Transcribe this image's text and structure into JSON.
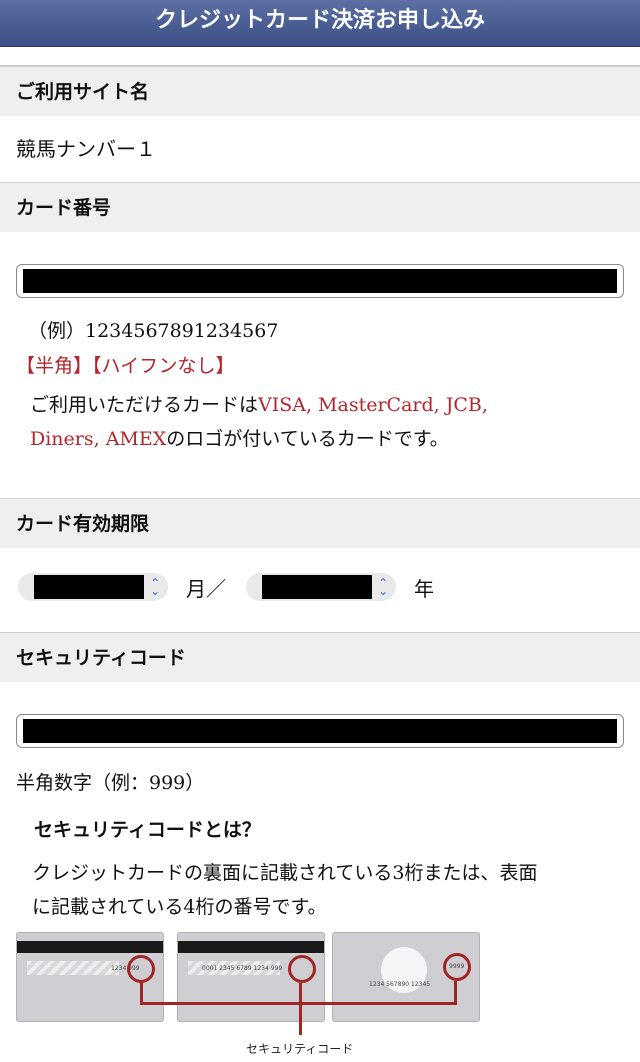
{
  "header": {
    "title": "クレジットカード決済お申し込み"
  },
  "site": {
    "label": "ご利用サイト名",
    "value": "競馬ナンバー１"
  },
  "card_number": {
    "label": "カード番号",
    "example": "（例）1234567891234567",
    "hint": "【半角】【ハイフンなし】",
    "notice_prefix": "ご利用いただけるカードは",
    "brands_line1": "VISA, MasterCard, JCB,",
    "brands_line2": "Diners, AMEX",
    "notice_suffix": "のロゴが付いているカードです。"
  },
  "expiry": {
    "label": "カード有効期限",
    "month_unit": "月／",
    "year_unit": "年"
  },
  "security": {
    "label": "セキュリティコード",
    "note": "半角数字（例：999）",
    "what_title": "セキュリティコードとは？",
    "desc_line1": "クレジットカードの裏面に記載されている3桁または、表面",
    "desc_line2": "に記載されている4桁の番号です。",
    "diagram_label": "セキュリティコード",
    "card1_num": "1234 999",
    "card2_num": "0001 2345 6789 1234 999",
    "card3_num": "1234 567890 12345",
    "card3_code": "9999"
  },
  "colors": {
    "header_bg": "#3b4f86",
    "accent_red": "#b2262c",
    "section_bg": "#efefef"
  }
}
